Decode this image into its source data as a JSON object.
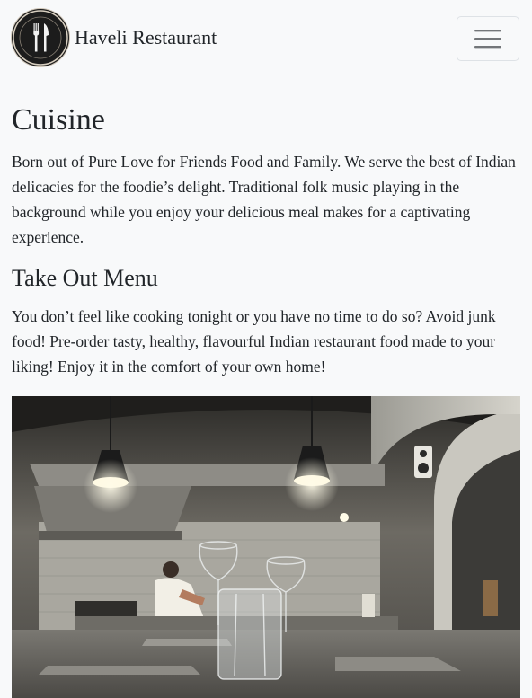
{
  "navbar": {
    "brand_name": "Haveli Restaurant",
    "logo_icon": "fork-knife-icon",
    "toggler_icon": "hamburger-menu-icon"
  },
  "main": {
    "title": "Cuisine",
    "intro": "Born out of Pure Love for Friends Food and Family. We serve the best of Indian delicacies for the foodie’s delight. Traditional folk music playing in the background while you enjoy your delicious meal makes for a captivating experience.",
    "takeout_title": "Take Out Menu",
    "takeout_text": "You don’t feel like cooking tonight or you have no time to do so? Avoid junk food! Pre-order tasty, healthy, flavourful Indian restaurant food made to your liking! Enjoy it in the comfort of your own home!"
  },
  "colors": {
    "background": "#f8f9fa",
    "text": "#212529",
    "logo_dark": "#1c1c1c"
  }
}
